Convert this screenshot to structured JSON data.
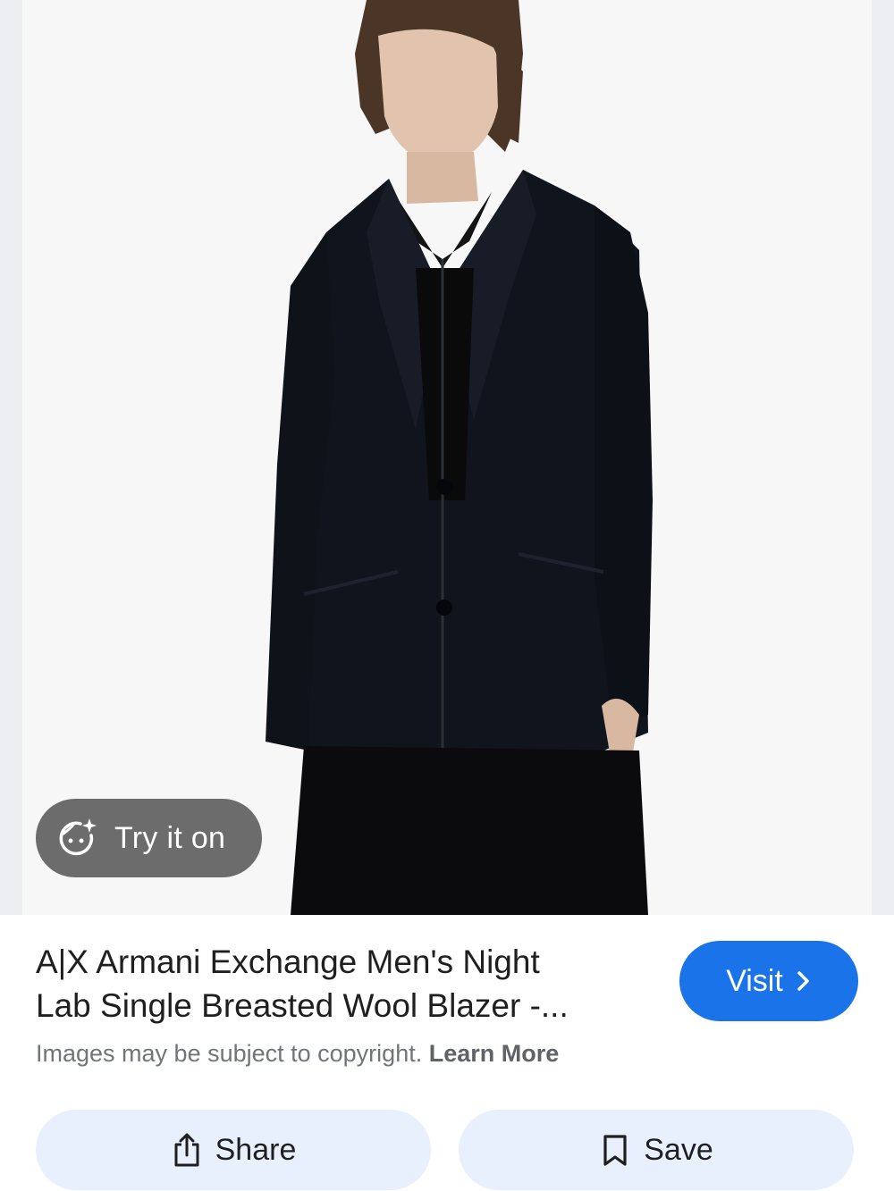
{
  "product": {
    "title_line1": "A|X Armani Exchange Men's Night",
    "title_line2": "Lab Single Breasted Wool Blazer -...",
    "copyright_text": "Images may be subject to copyright.",
    "learn_more": "Learn More"
  },
  "overlay": {
    "try_on_label": "Try it on",
    "try_on_icon": "face-sparkle-icon"
  },
  "actions": {
    "visit_label": "Visit",
    "visit_icon": "chevron-right-icon",
    "share_label": "Share",
    "share_icon": "share-icon",
    "save_label": "Save",
    "save_icon": "bookmark-icon"
  },
  "colors": {
    "accent": "#1a73e8",
    "action_bg": "#e8f0fe",
    "overlay_pill": "#5f5f5f"
  }
}
